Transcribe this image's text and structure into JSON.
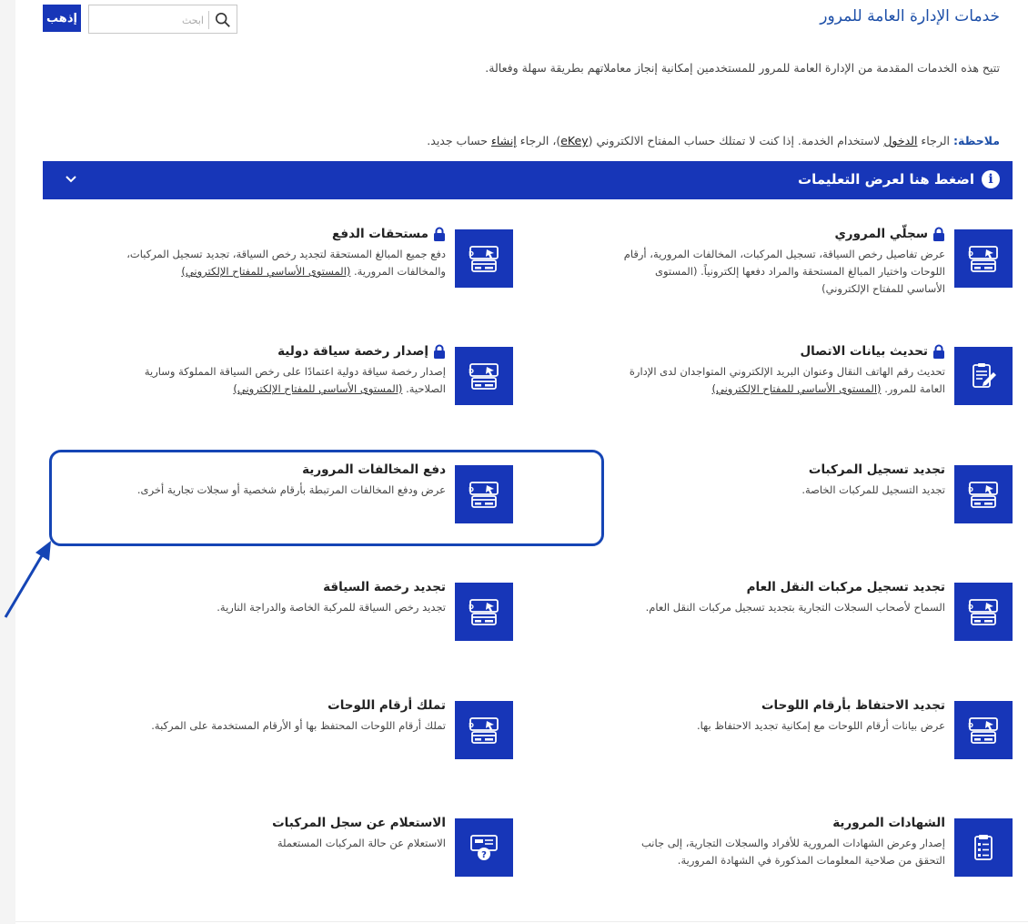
{
  "header": {
    "title": "خدمات الإدارة العامة للمرور",
    "search_placeholder": "ابحث",
    "go_label": "إذهب"
  },
  "intro": "تتيح هذه الخدمات المقدمة من الإدارة العامة للمرور للمستخدمين إمكانية إنجاز معاملاتهم بطريقة سهلة وفعالة.",
  "note": {
    "label": "ملاحظة:",
    "t1": " الرجاء ",
    "login_link": "الدخول",
    "t2": " لاستخدام الخدمة. إذا كنت لا تمتلك حساب المفتاح الالكتروني (",
    "ekey_link": "eKey",
    "t3": ")، الرجاء ",
    "create_link": "إنشاء",
    "t4": " حساب جديد."
  },
  "instructions": {
    "label": "اضغط هنا لعرض التعليمات"
  },
  "ekey_level_link": "(المستوى الأساسي للمفتاح الإلكتروني)",
  "services": [
    {
      "title": "سجلّي المروري",
      "icon": "card-payment-icon",
      "locked": true,
      "lines": [
        "عرض تفاصيل رخص السياقة، تسجيل المركبات، المخالفات المرورية، أرقام",
        "اللوحات واختيار المبالغ المستحقة والمراد دفعها إلكترونياً. (المستوى",
        "الأساسي للمفتاح الإلكتروني)"
      ]
    },
    {
      "title": "مستحقات الدفع",
      "icon": "card-payment-icon",
      "locked": true,
      "lines": [
        "دفع جميع المبالغ المستحقة لتجديد رخص السياقة، تجديد تسجيل المركبات،",
        "والمخالفات المرورية."
      ]
    },
    {
      "title": "تحديث بيانات الاتصال",
      "icon": "edit-document-icon",
      "locked": true,
      "lines": [
        "تحديث رقم الهاتف النقال وعنوان البريد الإلكتروني المتواجدان لدى الإدارة",
        "العامة للمرور."
      ]
    },
    {
      "title": "إصدار رخصة سياقة دولية",
      "icon": "card-payment-icon",
      "locked": true,
      "lines": [
        "إصدار رخصة سياقة دولية اعتمادًا على رخص السياقة المملوكة وسارية",
        "الصلاحية."
      ]
    },
    {
      "title": "تجديد تسجيل المركبات",
      "icon": "card-payment-icon",
      "locked": false,
      "lines": [
        "تجديد التسجيل للمركبات الخاصة."
      ]
    },
    {
      "title": "دفع المخالفات المرورية",
      "icon": "card-payment-icon",
      "locked": false,
      "lines": [
        "عرض ودفع المخالفات المرتبطة بأرقام شخصية أو سجلات تجارية أخرى."
      ]
    },
    {
      "title": "تجديد تسجيل مركبات النقل العام",
      "icon": "card-payment-icon",
      "locked": false,
      "lines": [
        "السماح لأصحاب السجلات التجارية بتجديد تسجيل مركبات النقل العام."
      ]
    },
    {
      "title": "تجديد رخصة السياقة",
      "icon": "card-payment-icon",
      "locked": false,
      "lines": [
        "تجديد رخص السياقة للمركبة الخاصة والدراجة النارية."
      ]
    },
    {
      "title": "تجديد الاحتفاظ بأرقام اللوحات",
      "icon": "card-payment-icon",
      "locked": false,
      "lines": [
        "عرض بيانات أرقام اللوحات مع إمكانية تجديد الاحتفاظ بها."
      ]
    },
    {
      "title": "تملك أرقام اللوحات",
      "icon": "card-payment-icon",
      "locked": false,
      "lines": [
        "تملك أرقام اللوحات المحتفظ بها أو الأرقام المستخدمة على المركبة."
      ]
    },
    {
      "title": "الشهادات المرورية",
      "icon": "certificate-clipboard-icon",
      "locked": false,
      "lines": [
        "إصدار وعرض الشهادات المرورية للأفراد والسجلات التجارية، إلى جانب",
        "التحقق من صلاحية المعلومات المذكورة في الشهادة المرورية."
      ]
    },
    {
      "title": "الاستعلام عن سجل المركبات",
      "icon": "vehicle-inquiry-icon",
      "locked": false,
      "lines": [
        "الاستعلام عن حالة المركبات المستعملة"
      ]
    }
  ],
  "colors": {
    "primary": "#1736b8",
    "title_blue": "#1d4fa8",
    "highlight": "#1545b5"
  }
}
